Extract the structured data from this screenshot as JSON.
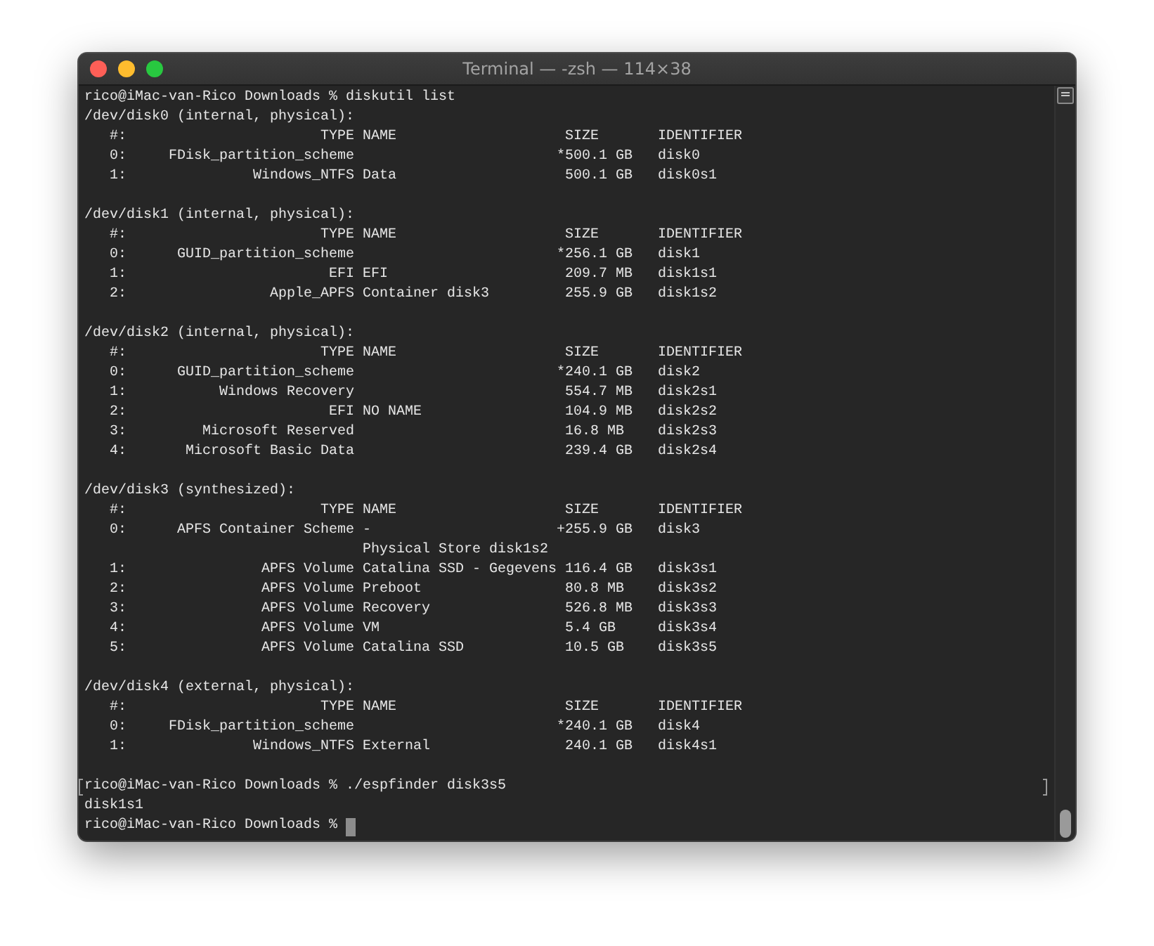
{
  "window": {
    "title": "Terminal — -zsh — 114×38"
  },
  "lines": [
    {
      "kind": "prompt",
      "text": "rico@iMac-van-Rico Downloads % diskutil list",
      "marked": false,
      "cursor": false
    },
    {
      "kind": "section",
      "text": "/dev/disk0 (internal, physical):"
    },
    {
      "kind": "header",
      "index": "#:",
      "type": "TYPE",
      "name": "NAME",
      "size": "SIZE",
      "identifier": "IDENTIFIER"
    },
    {
      "kind": "row",
      "index": "0:",
      "type": "FDisk_partition_scheme",
      "flag": "*",
      "size": "500.1 GB",
      "identifier": "disk0"
    },
    {
      "kind": "row",
      "index": "1:",
      "type": "Windows_NTFS",
      "name": "Data",
      "size": "500.1 GB",
      "identifier": "disk0s1"
    },
    {
      "kind": "blank"
    },
    {
      "kind": "section",
      "text": "/dev/disk1 (internal, physical):"
    },
    {
      "kind": "header",
      "index": "#:",
      "type": "TYPE",
      "name": "NAME",
      "size": "SIZE",
      "identifier": "IDENTIFIER"
    },
    {
      "kind": "row",
      "index": "0:",
      "type": "GUID_partition_scheme",
      "flag": "*",
      "size": "256.1 GB",
      "identifier": "disk1"
    },
    {
      "kind": "row",
      "index": "1:",
      "type": "EFI",
      "name": "EFI",
      "size": "209.7 MB",
      "identifier": "disk1s1"
    },
    {
      "kind": "row",
      "index": "2:",
      "type": "Apple_APFS",
      "name": "Container disk3",
      "size": "255.9 GB",
      "identifier": "disk1s2"
    },
    {
      "kind": "blank"
    },
    {
      "kind": "section",
      "text": "/dev/disk2 (internal, physical):"
    },
    {
      "kind": "header",
      "index": "#:",
      "type": "TYPE",
      "name": "NAME",
      "size": "SIZE",
      "identifier": "IDENTIFIER"
    },
    {
      "kind": "row",
      "index": "0:",
      "type": "GUID_partition_scheme",
      "flag": "*",
      "size": "240.1 GB",
      "identifier": "disk2"
    },
    {
      "kind": "row",
      "index": "1:",
      "type": "Windows Recovery",
      "size": "554.7 MB",
      "identifier": "disk2s1"
    },
    {
      "kind": "row",
      "index": "2:",
      "type": "EFI",
      "name": "NO NAME",
      "size": "104.9 MB",
      "identifier": "disk2s2"
    },
    {
      "kind": "row",
      "index": "3:",
      "type": "Microsoft Reserved",
      "size": "16.8 MB",
      "identifier": "disk2s3"
    },
    {
      "kind": "row",
      "index": "4:",
      "type": "Microsoft Basic Data",
      "size": "239.4 GB",
      "identifier": "disk2s4"
    },
    {
      "kind": "blank"
    },
    {
      "kind": "section",
      "text": "/dev/disk3 (synthesized):"
    },
    {
      "kind": "header",
      "index": "#:",
      "type": "TYPE",
      "name": "NAME",
      "size": "SIZE",
      "identifier": "IDENTIFIER"
    },
    {
      "kind": "row",
      "index": "0:",
      "type": "APFS Container Scheme",
      "name": "-",
      "flag": "+",
      "size": "255.9 GB",
      "identifier": "disk3"
    },
    {
      "kind": "row",
      "name": "Physical Store disk1s2"
    },
    {
      "kind": "row",
      "index": "1:",
      "type": "APFS Volume",
      "name": "Catalina SSD - Gegevens",
      "size": "116.4 GB",
      "identifier": "disk3s1"
    },
    {
      "kind": "row",
      "index": "2:",
      "type": "APFS Volume",
      "name": "Preboot",
      "size": "80.8 MB",
      "identifier": "disk3s2"
    },
    {
      "kind": "row",
      "index": "3:",
      "type": "APFS Volume",
      "name": "Recovery",
      "size": "526.8 MB",
      "identifier": "disk3s3"
    },
    {
      "kind": "row",
      "index": "4:",
      "type": "APFS Volume",
      "name": "VM",
      "size": "5.4 GB",
      "identifier": "disk3s4"
    },
    {
      "kind": "row",
      "index": "5:",
      "type": "APFS Volume",
      "name": "Catalina SSD",
      "size": "10.5 GB",
      "identifier": "disk3s5"
    },
    {
      "kind": "blank"
    },
    {
      "kind": "section",
      "text": "/dev/disk4 (external, physical):"
    },
    {
      "kind": "header",
      "index": "#:",
      "type": "TYPE",
      "name": "NAME",
      "size": "SIZE",
      "identifier": "IDENTIFIER"
    },
    {
      "kind": "row",
      "index": "0:",
      "type": "FDisk_partition_scheme",
      "flag": "*",
      "size": "240.1 GB",
      "identifier": "disk4"
    },
    {
      "kind": "row",
      "index": "1:",
      "type": "Windows_NTFS",
      "name": "External",
      "size": "240.1 GB",
      "identifier": "disk4s1"
    },
    {
      "kind": "blank"
    },
    {
      "kind": "prompt",
      "text": "rico@iMac-van-Rico Downloads % ./espfinder disk3s5",
      "marked": true,
      "cursor": false
    },
    {
      "kind": "output",
      "text": "disk1s1"
    },
    {
      "kind": "prompt",
      "text": "rico@iMac-van-Rico Downloads %",
      "marked": false,
      "cursor": true
    }
  ]
}
